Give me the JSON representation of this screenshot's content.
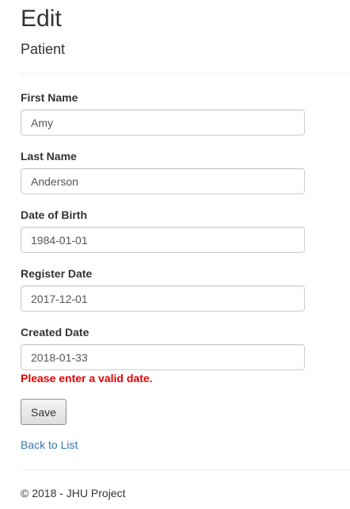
{
  "header": {
    "title": "Edit",
    "subtitle": "Patient"
  },
  "form": {
    "fields": [
      {
        "label": "First Name",
        "value": "Amy"
      },
      {
        "label": "Last Name",
        "value": "Anderson"
      },
      {
        "label": "Date of Birth",
        "value": "1984-01-01"
      },
      {
        "label": "Register Date",
        "value": "2017-12-01"
      },
      {
        "label": "Created Date",
        "value": "2018-01-33"
      }
    ],
    "error_message": "Please enter a valid date.",
    "save_label": "Save"
  },
  "nav": {
    "back_label": "Back to List"
  },
  "footer": {
    "text": "© 2018 - JHU Project"
  },
  "colors": {
    "error": "#e60000",
    "link": "#337ab7"
  }
}
